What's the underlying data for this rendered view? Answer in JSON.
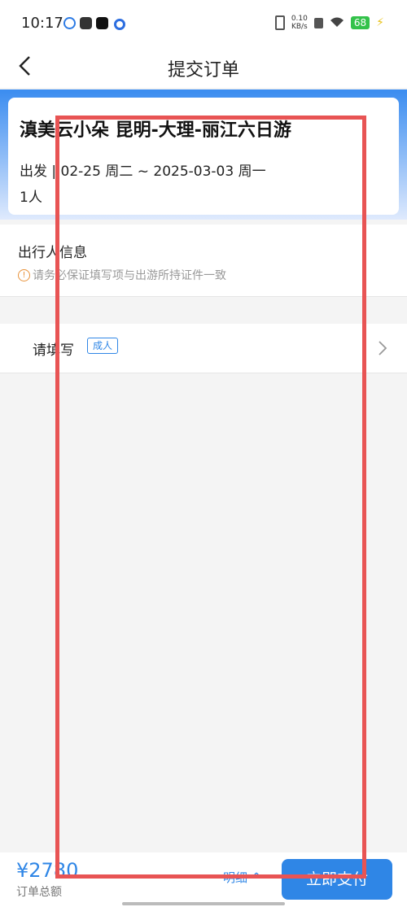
{
  "status_bar": {
    "time": "10:17",
    "network_speed_value": "0.10",
    "network_speed_unit": "KB/s",
    "battery": "68",
    "icons": [
      "notification-icon",
      "app-icon",
      "tiktok-icon",
      "circle-app-icon",
      "vibrate-icon",
      "sim-off-icon",
      "wifi-icon",
      "battery-icon",
      "charging-icon"
    ]
  },
  "nav": {
    "title": "提交订单",
    "back_icon": "back-arrow-icon"
  },
  "trip": {
    "title": "滇美云小朵 昆明-大理-丽江六日游",
    "dates": "出发 | 02-25 周二 ~ 2025-03-03 周一",
    "travelers": "1人"
  },
  "traveler_section": {
    "title": "出行人信息",
    "notice": "请务必保证填写项与出游所持证件一致"
  },
  "fill_row": {
    "label": "请填写",
    "tag": "成人"
  },
  "bottom_bar": {
    "price": "¥2780",
    "price_label": "订单总额",
    "detail": "明细 ^",
    "pay_button": "立即支付"
  },
  "colors": {
    "accent": "#2f86e6",
    "highlight": "#e85454",
    "header_gradient_top": "#3a8cf0"
  }
}
